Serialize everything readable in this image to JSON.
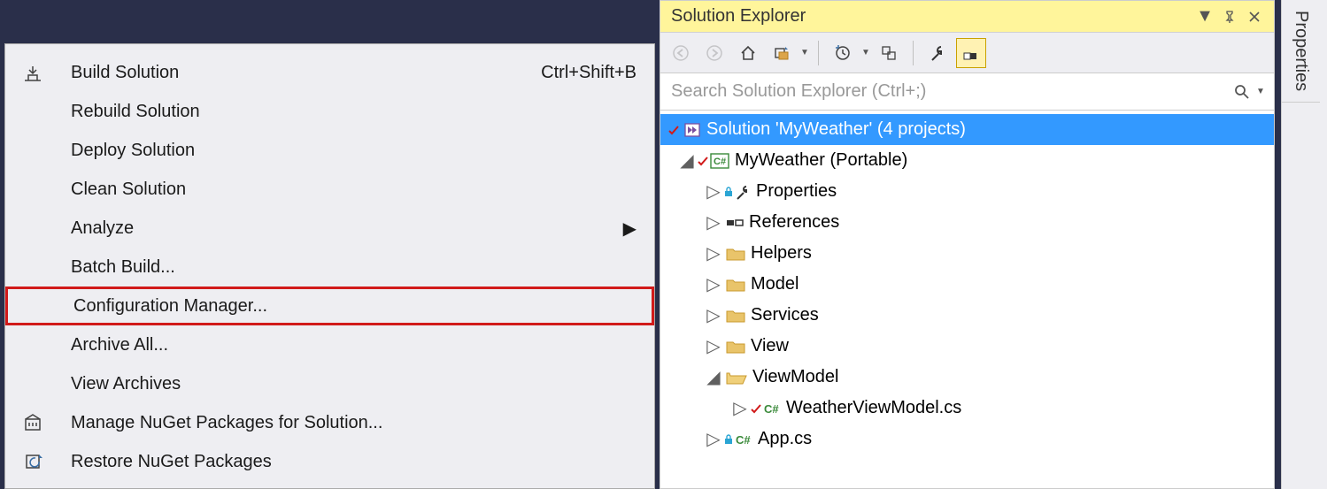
{
  "context_menu": {
    "items": [
      {
        "label": "Build Solution",
        "shortcut": "Ctrl+Shift+B",
        "icon": "build",
        "submenu": false
      },
      {
        "label": "Rebuild Solution",
        "shortcut": "",
        "icon": "",
        "submenu": false
      },
      {
        "label": "Deploy Solution",
        "shortcut": "",
        "icon": "",
        "submenu": false
      },
      {
        "label": "Clean Solution",
        "shortcut": "",
        "icon": "",
        "submenu": false
      },
      {
        "label": "Analyze",
        "shortcut": "",
        "icon": "",
        "submenu": true
      },
      {
        "label": "Batch Build...",
        "shortcut": "",
        "icon": "",
        "submenu": false
      },
      {
        "label": "Configuration Manager...",
        "shortcut": "",
        "icon": "",
        "submenu": false,
        "highlighted": true
      },
      {
        "label": "Archive All...",
        "shortcut": "",
        "icon": "",
        "submenu": false
      },
      {
        "label": "View Archives",
        "shortcut": "",
        "icon": "",
        "submenu": false
      },
      {
        "label": "Manage NuGet Packages for Solution...",
        "shortcut": "",
        "icon": "package",
        "submenu": false
      },
      {
        "label": "Restore NuGet Packages",
        "shortcut": "",
        "icon": "restore",
        "submenu": false
      }
    ]
  },
  "solution_explorer": {
    "title": "Solution Explorer",
    "search_placeholder": "Search Solution Explorer (Ctrl+;)",
    "root": {
      "label": "Solution 'MyWeather' (4 projects)",
      "icon": "solution"
    },
    "tree": [
      {
        "depth": 1,
        "expanded": true,
        "icon": "csproj-check",
        "label": "MyWeather (Portable)"
      },
      {
        "depth": 2,
        "expanded": false,
        "icon": "wrench",
        "label": "Properties"
      },
      {
        "depth": 2,
        "expanded": false,
        "icon": "references",
        "label": "References"
      },
      {
        "depth": 2,
        "expanded": false,
        "icon": "folder",
        "label": "Helpers"
      },
      {
        "depth": 2,
        "expanded": false,
        "icon": "folder",
        "label": "Model"
      },
      {
        "depth": 2,
        "expanded": false,
        "icon": "folder",
        "label": "Services"
      },
      {
        "depth": 2,
        "expanded": false,
        "icon": "folder",
        "label": "View"
      },
      {
        "depth": 2,
        "expanded": true,
        "icon": "folder-open",
        "label": "ViewModel"
      },
      {
        "depth": 3,
        "expanded": false,
        "icon": "csfile-check",
        "label": "WeatherViewModel.cs"
      },
      {
        "depth": 2,
        "expanded": false,
        "icon": "csfile-lock",
        "label": "App.cs"
      }
    ]
  },
  "side_rail": {
    "tab": "Properties"
  }
}
